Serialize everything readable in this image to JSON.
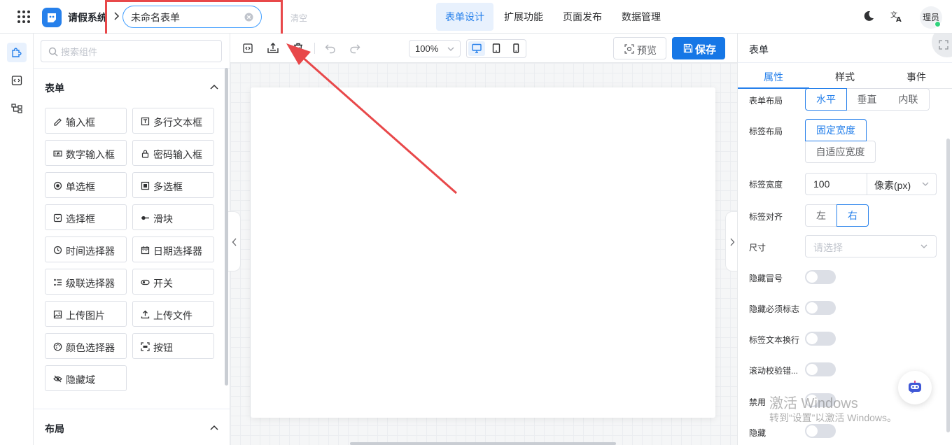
{
  "header": {
    "app_title": "请假系统",
    "form_name": "未命名表单",
    "clear_label": "清空",
    "tabs": [
      {
        "label": "表单设计",
        "active": true
      },
      {
        "label": "扩展功能",
        "active": false
      },
      {
        "label": "页面发布",
        "active": false
      },
      {
        "label": "数据管理",
        "active": false
      }
    ],
    "user_label": "理员",
    "icons": [
      "apps-grid-icon",
      "app-logo-icon",
      "chevron-right-icon",
      "clear-circle-icon",
      "moon-icon",
      "translate-icon"
    ]
  },
  "rail": {
    "icons": [
      "puzzle-icon",
      "code-icon",
      "tree-icon"
    ],
    "active_index": 0
  },
  "components": {
    "search_placeholder": "搜索组件",
    "groups": [
      {
        "title": "表单",
        "expanded": true,
        "items": [
          {
            "label": "输入框",
            "icon": "pencil-icon"
          },
          {
            "label": "多行文本框",
            "icon": "textarea-icon"
          },
          {
            "label": "数字输入框",
            "icon": "number-icon"
          },
          {
            "label": "密码输入框",
            "icon": "lock-icon"
          },
          {
            "label": "单选框",
            "icon": "radio-icon"
          },
          {
            "label": "多选框",
            "icon": "checkbox-icon"
          },
          {
            "label": "选择框",
            "icon": "select-icon"
          },
          {
            "label": "滑块",
            "icon": "slider-icon"
          },
          {
            "label": "时间选择器",
            "icon": "clock-icon"
          },
          {
            "label": "日期选择器",
            "icon": "calendar-icon"
          },
          {
            "label": "级联选择器",
            "icon": "cascader-icon"
          },
          {
            "label": "开关",
            "icon": "switch-icon"
          },
          {
            "label": "上传图片",
            "icon": "image-icon"
          },
          {
            "label": "上传文件",
            "icon": "upload-icon"
          },
          {
            "label": "颜色选择器",
            "icon": "palette-icon"
          },
          {
            "label": "按钮",
            "icon": "button-icon"
          },
          {
            "label": "隐藏域",
            "icon": "eye-off-icon"
          }
        ]
      },
      {
        "title": "布局",
        "expanded": true,
        "items": []
      }
    ]
  },
  "toolbar": {
    "zoom": "100%",
    "device_active": "desktop",
    "preview_label": "预览",
    "save_label": "保存",
    "icons": [
      "code-view-icon",
      "import-icon",
      "trash-icon",
      "undo-icon",
      "redo-icon",
      "desktop-icon",
      "tablet-icon",
      "mobile-icon"
    ]
  },
  "properties": {
    "title": "表单",
    "tabs": [
      {
        "label": "属性",
        "active": true
      },
      {
        "label": "样式",
        "active": false
      },
      {
        "label": "事件",
        "active": false
      }
    ],
    "form_layout": {
      "label": "表单布局",
      "options": [
        "水平",
        "垂直",
        "内联"
      ],
      "selected": "水平"
    },
    "label_layout": {
      "label": "标签布局",
      "options": [
        "固定宽度",
        "自适应宽度"
      ],
      "selected": "固定宽度"
    },
    "label_width": {
      "label": "标签宽度",
      "value": "100",
      "unit": "像素(px)"
    },
    "label_align": {
      "label": "标签对齐",
      "options": [
        "左",
        "右"
      ],
      "selected": "右"
    },
    "size": {
      "label": "尺寸",
      "placeholder": "请选择"
    },
    "switches": [
      {
        "label": "隐藏冒号",
        "on": false
      },
      {
        "label": "隐藏必须标志",
        "on": false
      },
      {
        "label": "标签文本换行",
        "on": false
      },
      {
        "label": "滚动校验错...",
        "on": false
      },
      {
        "label": "禁用",
        "on": false
      },
      {
        "label": "隐藏",
        "on": false
      }
    ]
  },
  "watermark": {
    "title": "激活 Windows",
    "subtitle": "转到“设置”以激活 Windows。"
  },
  "colors": {
    "primary": "#2680eb",
    "save_button": "#1677e6",
    "annotation": "#e8484a"
  }
}
